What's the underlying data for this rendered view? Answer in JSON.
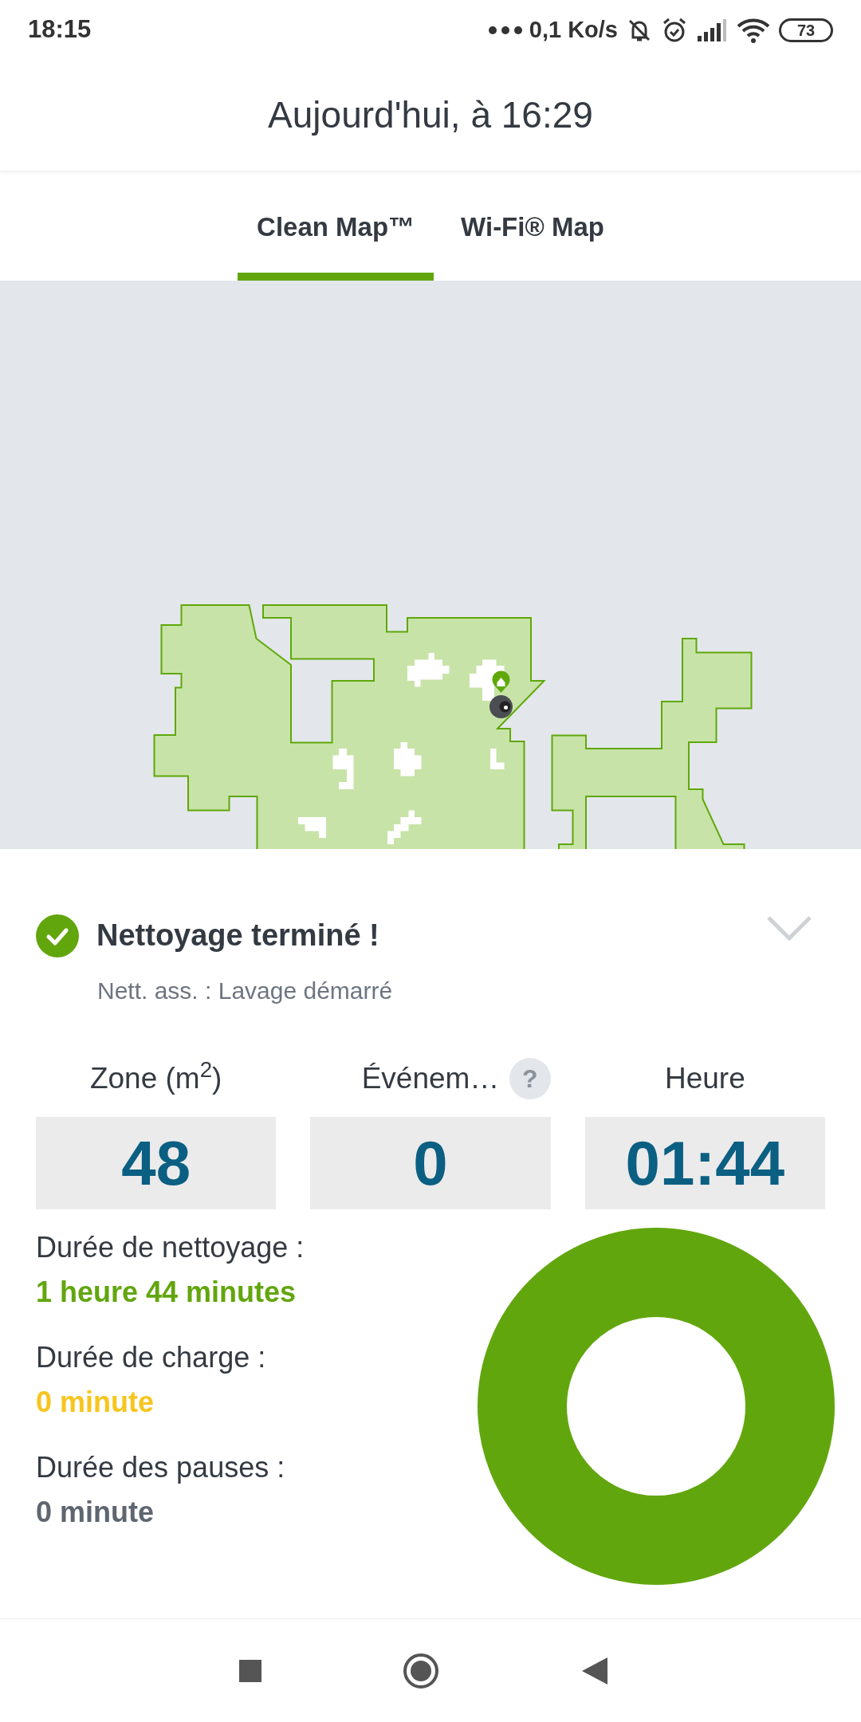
{
  "status_bar": {
    "time": "18:15",
    "network_speed": "0,1 Ko/s",
    "battery": "73"
  },
  "header": {
    "title": "Aujourd'hui, à 16:29"
  },
  "tabs": [
    {
      "label": "Clean Map™",
      "selected": true
    },
    {
      "label": "Wi-Fi® Map",
      "selected": false
    }
  ],
  "status": {
    "title": "Nettoyage terminé !",
    "subtitle": "Nett. ass. : Lavage démarré"
  },
  "stats": [
    {
      "label": "Zone (m$^{2}$)",
      "value": "48"
    },
    {
      "label": "Événem…",
      "value": "0",
      "help": "?"
    },
    {
      "label": "Heure",
      "value": "01:44"
    }
  ],
  "durations": [
    {
      "label": "Durée de nettoyage :",
      "value": "1 heure 44 minutes",
      "color": "#62a60e"
    },
    {
      "label": "Durée de charge :",
      "value": "0 minute",
      "color": "#f7c51e"
    },
    {
      "label": "Durée des pauses :",
      "value": "0 minute",
      "color": "#5f6670"
    }
  ]
}
